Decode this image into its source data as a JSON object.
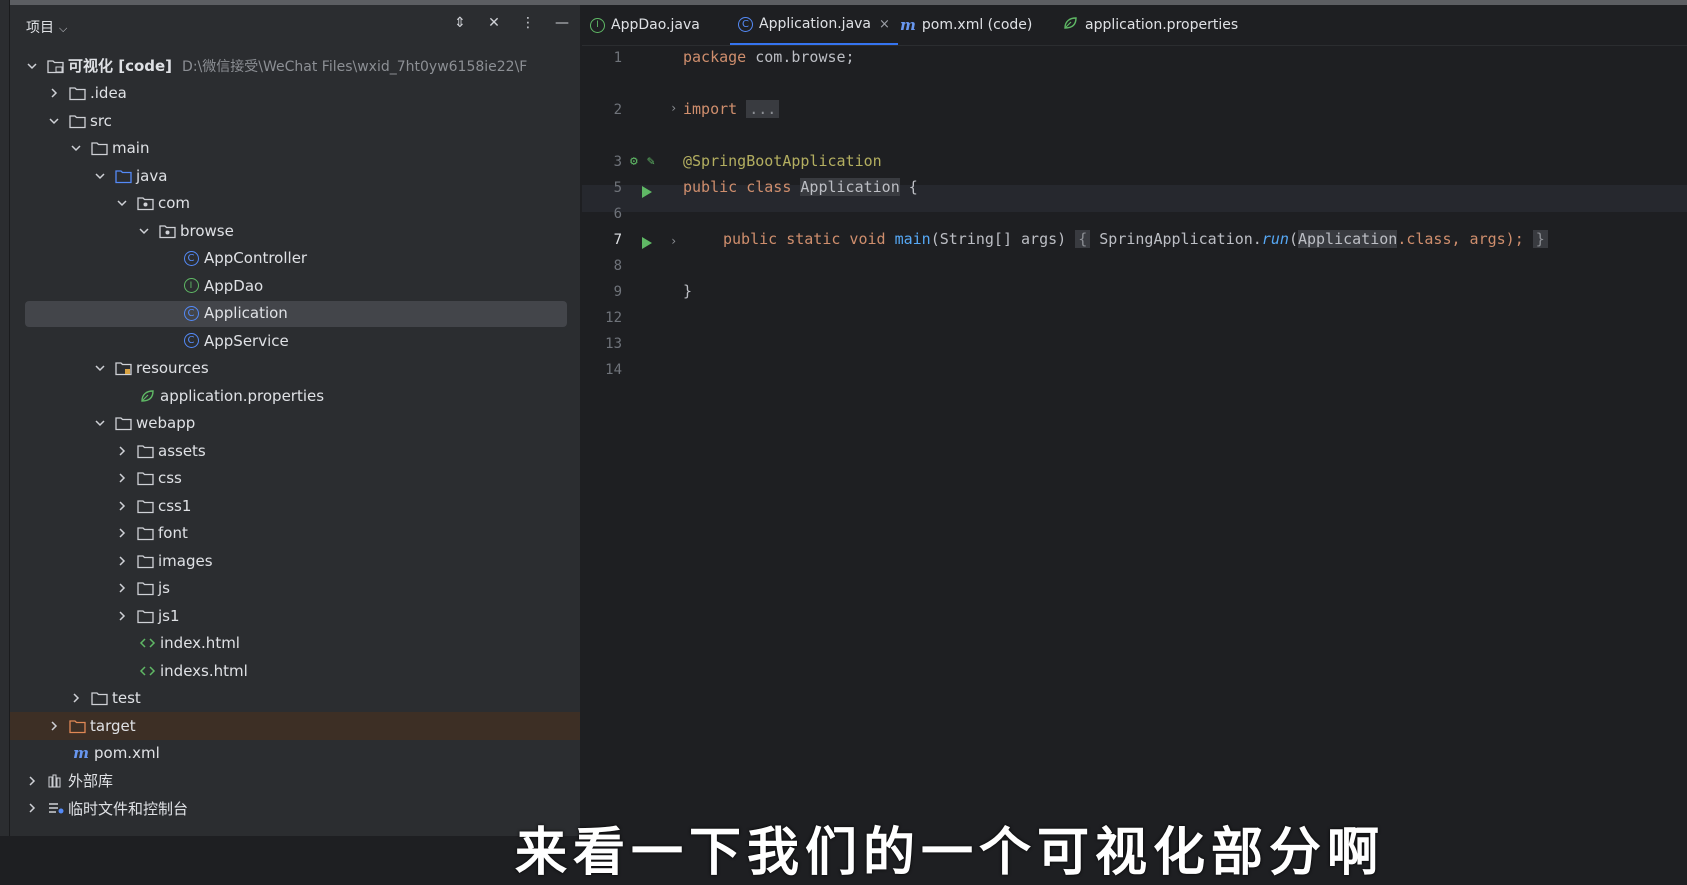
{
  "project_panel": {
    "title": "项目",
    "tree": [
      {
        "label": "可视化 [code]",
        "path": "D:\\微信接受\\WeChat Files\\wxid_7ht0yw6158ie22\\F",
        "icon": "module-folder-icon"
      },
      {
        "label": ".idea",
        "icon": "folder-icon"
      },
      {
        "label": "src",
        "icon": "folder-icon"
      },
      {
        "label": "main",
        "icon": "folder-icon"
      },
      {
        "label": "java",
        "icon": "source-folder-icon"
      },
      {
        "label": "com",
        "icon": "package-icon"
      },
      {
        "label": "browse",
        "icon": "package-icon"
      },
      {
        "label": "AppController",
        "icon": "class-icon"
      },
      {
        "label": "AppDao",
        "icon": "interface-icon"
      },
      {
        "label": "Application",
        "icon": "spring-boot-class-icon"
      },
      {
        "label": "AppService",
        "icon": "class-icon"
      },
      {
        "label": "resources",
        "icon": "resources-folder-icon"
      },
      {
        "label": "application.properties",
        "icon": "spring-properties-icon"
      },
      {
        "label": "webapp",
        "icon": "folder-icon"
      },
      {
        "label": "assets",
        "icon": "folder-icon"
      },
      {
        "label": "css",
        "icon": "folder-icon"
      },
      {
        "label": "css1",
        "icon": "folder-icon"
      },
      {
        "label": "font",
        "icon": "folder-icon"
      },
      {
        "label": "images",
        "icon": "folder-icon"
      },
      {
        "label": "js",
        "icon": "folder-icon"
      },
      {
        "label": "js1",
        "icon": "folder-icon"
      },
      {
        "label": "index.html",
        "icon": "html-file-icon"
      },
      {
        "label": "indexs.html",
        "icon": "html-file-icon"
      },
      {
        "label": "test",
        "icon": "folder-icon"
      },
      {
        "label": "target",
        "icon": "excluded-folder-icon"
      },
      {
        "label": "pom.xml",
        "icon": "maven-icon"
      },
      {
        "label": "外部库",
        "icon": "library-icon"
      },
      {
        "label": "临时文件和控制台",
        "icon": "scratch-icon"
      }
    ]
  },
  "tabs": [
    {
      "label": "AppDao.java",
      "icon": "interface-icon"
    },
    {
      "label": "Application.java",
      "icon": "spring-boot-class-icon",
      "active": true
    },
    {
      "label": "pom.xml (code)",
      "icon": "maven-icon"
    },
    {
      "label": "application.properties",
      "icon": "spring-properties-icon"
    }
  ],
  "editor": {
    "line_numbers": [
      "1",
      "2",
      "3",
      "5",
      "6",
      "7",
      "8",
      "9",
      "12",
      "13",
      "14"
    ],
    "current_line": "7",
    "code": {
      "l1_kw": "package",
      "l1_rest": " com.browse;",
      "l3_kw": "import",
      "l3_fold": "...",
      "l6": "@SpringBootApplication",
      "l7_kw": "public class",
      "l7_name": "Application",
      "l7_rest": " {",
      "l9_kw": "public static void",
      "l9_fn": "main",
      "l9_args": "(String[] args)",
      "l9_open": "{",
      "l9_call": "SpringApplication.",
      "l9_run": "run",
      "l9_arg1": "Application",
      "l9_rest": ".class, args);",
      "l9_close": "}",
      "l13": "}"
    }
  },
  "subtitle": "来看一下我们的一个可视化部分啊"
}
